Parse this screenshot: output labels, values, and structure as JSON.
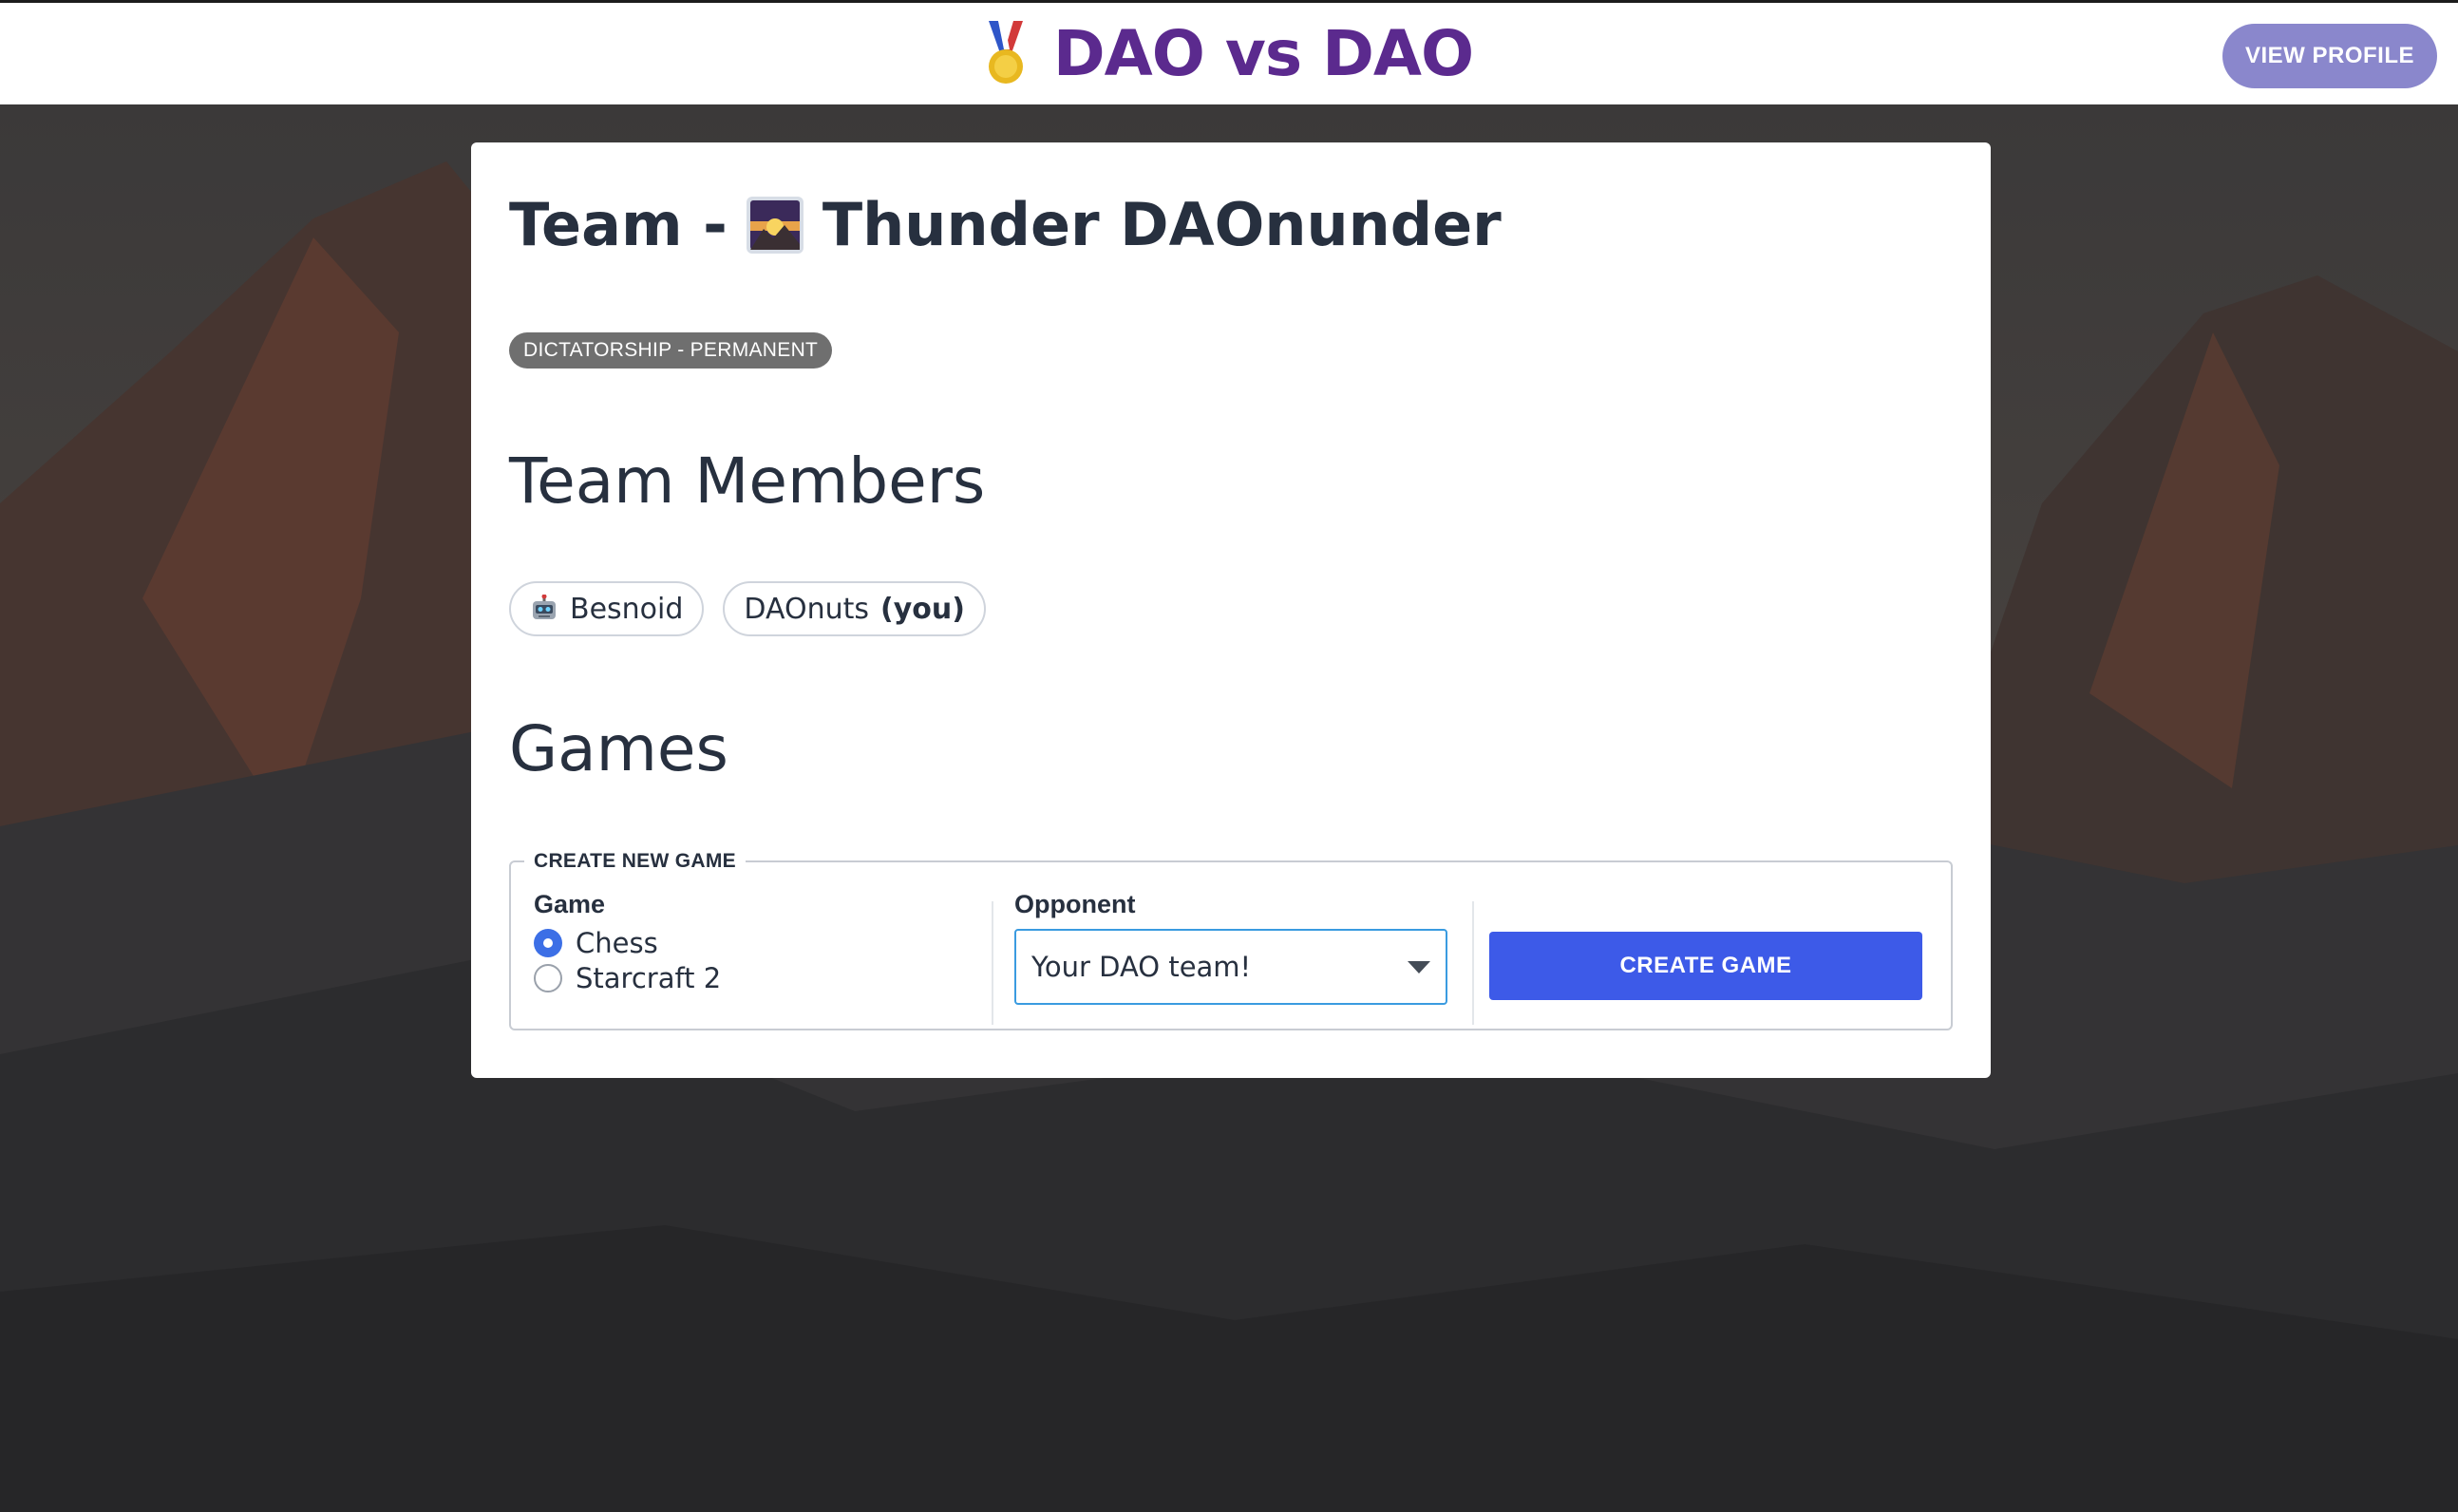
{
  "header": {
    "title": "DAO vs DAO",
    "logo_icon": "medal-icon",
    "view_profile_label": "VIEW PROFILE"
  },
  "team": {
    "title_prefix": "Team -",
    "icon": "sunrise-over-mountains-icon",
    "name": "Thunder DAOnunder",
    "governance_badge": "DICTATORSHIP - PERMANENT"
  },
  "members_section": {
    "heading": "Team Members",
    "members": [
      {
        "name": "Besnoid",
        "icon": "robot-icon",
        "suffix": ""
      },
      {
        "name": "DAOnuts",
        "icon": "",
        "suffix": "(you)"
      }
    ]
  },
  "games_section": {
    "heading": "Games",
    "create_form": {
      "legend": "CREATE NEW GAME",
      "game_label": "Game",
      "game_options": [
        {
          "label": "Chess",
          "checked": true
        },
        {
          "label": "Starcraft 2",
          "checked": false
        }
      ],
      "opponent_label": "Opponent",
      "opponent_selected": "Your DAO team!",
      "submit_label": "CREATE GAME"
    }
  },
  "colors": {
    "brand_purple": "#5b2a8e",
    "profile_button": "#8a87cc",
    "primary_button": "#3d5ae8",
    "badge_gray": "#6f6f6f"
  }
}
